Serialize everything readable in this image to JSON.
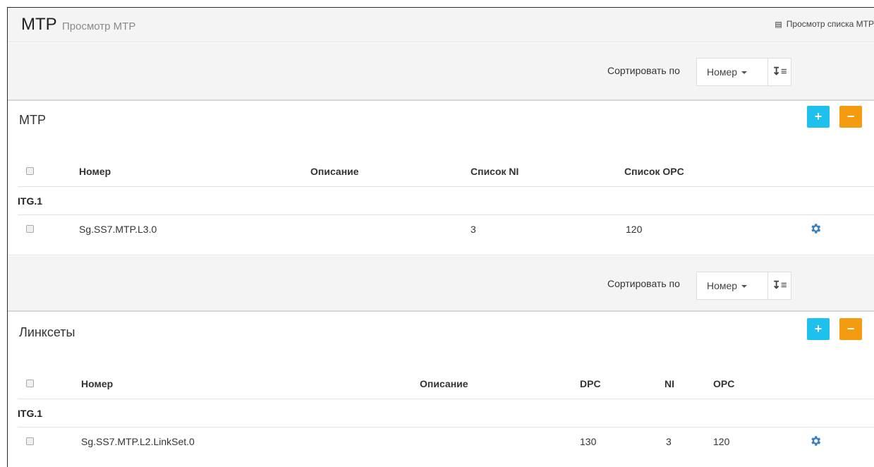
{
  "header": {
    "title": "МТР",
    "subtitle": "Просмотр МТР",
    "view_list_label": "Просмотр списка МТР",
    "view_list_icon": "list-icon"
  },
  "sort": {
    "label": "Сортировать по",
    "selected": "Номер",
    "direction_icon": "sort-asc-icon"
  },
  "mtp_panel": {
    "title": "МТР",
    "add_label": "+",
    "remove_label": "−",
    "columns": [
      "Номер",
      "Описание",
      "Список NI",
      "Список OPC"
    ],
    "group": "ITG.1",
    "rows": [
      {
        "number": "Sg.SS7.MTP.L3.0",
        "description": "",
        "ni_list": "3",
        "opc_list": "120"
      }
    ]
  },
  "linksets_panel": {
    "title": "Линксеты",
    "add_label": "+",
    "remove_label": "−",
    "columns": [
      "Номер",
      "Описание",
      "DPC",
      "NI",
      "OPC"
    ],
    "group": "ITG.1",
    "rows": [
      {
        "number": "Sg.SS7.MTP.L2.LinkSet.0",
        "description": "",
        "dpc": "130",
        "ni": "3",
        "opc": "120"
      }
    ]
  },
  "colors": {
    "add_button": "#1ec0ee",
    "remove_button": "#f39c12",
    "gear_icon": "#3a7fbf",
    "header_bg": "#f4f4f4"
  }
}
